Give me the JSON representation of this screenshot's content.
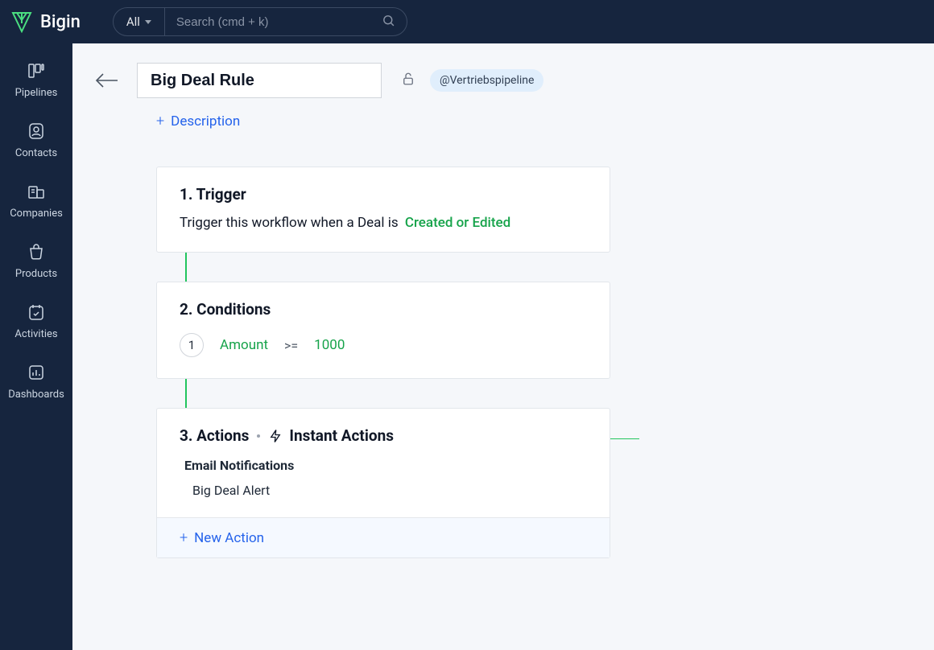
{
  "brand": {
    "name": "Bigin"
  },
  "search": {
    "filter_label": "All",
    "placeholder": "Search (cmd + k)"
  },
  "sidebar": {
    "items": [
      {
        "label": "Pipelines"
      },
      {
        "label": "Contacts"
      },
      {
        "label": "Companies"
      },
      {
        "label": "Products"
      },
      {
        "label": "Activities"
      },
      {
        "label": "Dashboards"
      }
    ]
  },
  "rule": {
    "title": "Big Deal Rule",
    "pipeline_mention": "@Vertriebspipeline",
    "add_description_label": "Description"
  },
  "trigger": {
    "heading": "1. Trigger",
    "prefix_text": "Trigger this workflow when a Deal is",
    "event": "Created or Edited"
  },
  "conditions": {
    "heading": "2. Conditions",
    "rows": [
      {
        "index": "1",
        "field": "Amount",
        "operator": ">=",
        "value": "1000"
      }
    ]
  },
  "actions": {
    "heading": "3. Actions",
    "instant_label": "Instant Actions",
    "groups": [
      {
        "name": "Email Notifications",
        "items": [
          "Big Deal Alert"
        ]
      }
    ],
    "new_action_label": "New Action"
  }
}
